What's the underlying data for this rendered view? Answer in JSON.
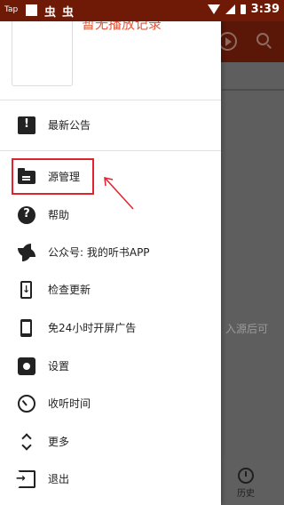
{
  "status_bar": {
    "tag": "Tap",
    "bug_icon_1": "bug-icon",
    "bug_icon_2": "bug-icon",
    "time": "3:39"
  },
  "drawer": {
    "header_text": "暂无播放记录",
    "items": [
      {
        "label": "最新公告",
        "icon": "notice-icon"
      },
      {
        "label": "源管理",
        "icon": "folder-icon"
      },
      {
        "label": "帮助",
        "icon": "help-icon"
      },
      {
        "label": "公众号: 我的听书APP",
        "icon": "fan-icon"
      },
      {
        "label": "检查更新",
        "icon": "phone-download-icon"
      },
      {
        "label": "免24小时开屏广告",
        "icon": "phone-icon"
      },
      {
        "label": "设置",
        "icon": "gear-icon"
      },
      {
        "label": "收听时间",
        "icon": "timer-icon"
      },
      {
        "label": "更多",
        "icon": "expand-icon"
      },
      {
        "label": "退出",
        "icon": "exit-icon"
      }
    ]
  },
  "background": {
    "hint_text": "入源后可",
    "history_label": "历史"
  },
  "colors": {
    "status_bar": "#6e1a07",
    "accent_text": "#e2563b",
    "highlight": "#e0232e"
  }
}
